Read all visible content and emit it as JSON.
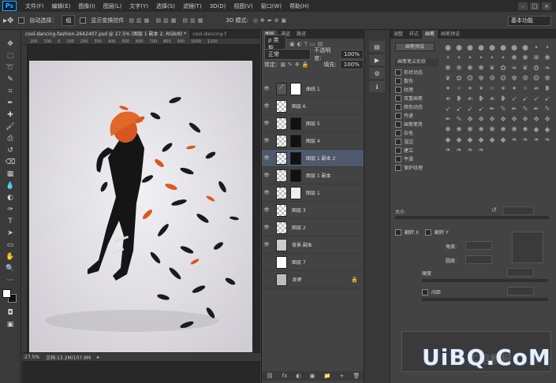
{
  "app": {
    "logo": "Ps"
  },
  "menu": [
    "文件(F)",
    "编辑(E)",
    "图像(I)",
    "图层(L)",
    "文字(Y)",
    "选择(S)",
    "滤镜(T)",
    "3D(D)",
    "视图(V)",
    "窗口(W)",
    "帮助(H)"
  ],
  "window_controls": [
    "–",
    "□",
    "×"
  ],
  "options": {
    "auto_select": "自动选择：",
    "auto_select_value": "组",
    "show_transform": "显示变换控件",
    "mode_3d": "3D 模式:",
    "workspace": "基本功能"
  },
  "doc_tabs": [
    "cool-dancing-fashion-2642407.psd @ 27.5% (图层 1 副本 2, RGB/8) *",
    "cool-dancing-f"
  ],
  "ruler_marks": [
    "200",
    "100",
    "0",
    "100",
    "200",
    "300",
    "400",
    "500",
    "600",
    "700",
    "800",
    "900",
    "1000",
    "1100"
  ],
  "status": {
    "zoom": "27.5%",
    "doc_size": "文档:13.2M/107.9M"
  },
  "layers_panel": {
    "tabs": [
      "图层",
      "通道",
      "路径"
    ],
    "kind_label": "ρ 类型",
    "blend_mode": "正常",
    "opacity_label": "不透明度:",
    "opacity_value": "100%",
    "lock_label": "锁定:",
    "fill_label": "填充:",
    "fill_value": "100%",
    "layers": [
      {
        "name": "曲线 1",
        "mask": true,
        "selected": false
      },
      {
        "name": "图层 6",
        "mask": false,
        "selected": false
      },
      {
        "name": "图层 5",
        "mask": true,
        "selected": false
      },
      {
        "name": "图层 4",
        "mask": true,
        "selected": false
      },
      {
        "name": "图层 1 副本 2",
        "mask": true,
        "selected": true
      },
      {
        "name": "图层 1 副本",
        "mask": true,
        "selected": false
      },
      {
        "name": "图层 1",
        "mask": true,
        "selected": false
      },
      {
        "name": "图层 3",
        "mask": false,
        "selected": false
      },
      {
        "name": "图层 2",
        "mask": false,
        "selected": false
      },
      {
        "name": "背景 副本",
        "mask": false,
        "selected": false
      },
      {
        "name": "图层 7",
        "mask": false,
        "selected": false
      },
      {
        "name": "背景",
        "mask": false,
        "selected": false
      }
    ],
    "footer_icons": [
      "fx",
      "◐",
      "▣",
      "📁",
      "+",
      "🗑"
    ]
  },
  "brush_panel": {
    "tabs": [
      "调整",
      "样式",
      "画笔",
      "画笔预设"
    ],
    "preset_button": "画笔预设",
    "section_title": "画笔笔尖形状",
    "options": [
      "形状动态",
      "散布",
      "纹理",
      "双重画笔",
      "颜色动态",
      "传递",
      "画笔笔势",
      "杂色",
      "湿边",
      "建立",
      "平滑",
      "保护纹理"
    ],
    "size_label": "大小",
    "flip_x": "翻转 X",
    "flip_y": "翻转 Y",
    "angle_label": "角度:",
    "roundness_label": "圆度:",
    "hardness_label": "硬度",
    "spacing_label": "间距"
  },
  "watermark": {
    "text": "UiBQ.CoM",
    "caption": "实用教程"
  }
}
